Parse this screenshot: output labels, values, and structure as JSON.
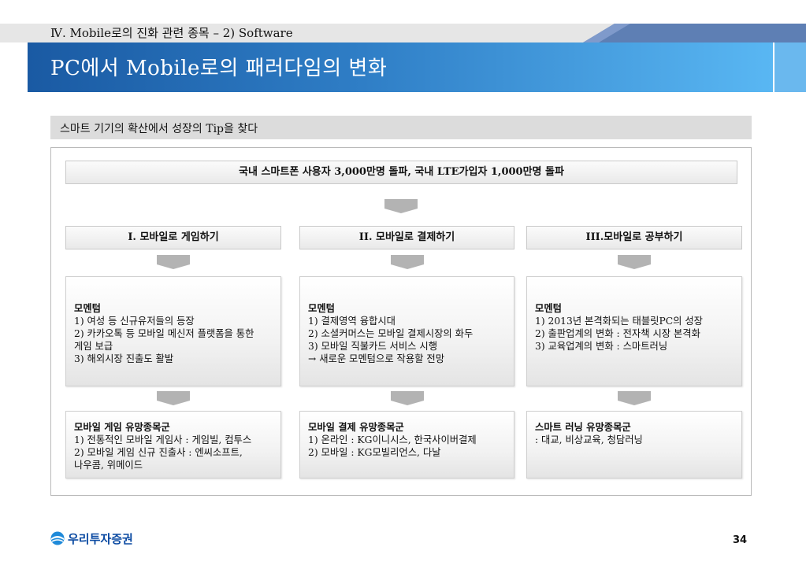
{
  "header": {
    "section_label": "Ⅳ. Mobile로의 진화 관련 종목 – 2) Software",
    "page_title": "PC에서 Mobile로의 패러다임의 변화"
  },
  "sub_heading": "스마트 기기의 확산에서 성장의 Tip을 찾다",
  "summary": "국내 스마트폰 사용자 3,000만명 돌파, 국내 LTE가입자 1,000만명 돌파",
  "columns": [
    {
      "heading": "I. 모바일로 게임하기",
      "momentum": {
        "title": "모멘텀",
        "lines": [
          "1) 여성 등 신규유저들의 등장",
          "2) 카카오톡 등 모바일 메신저 플랫폼을 통한",
          " 게임 보급",
          "3) 해외시장 진출도 활발"
        ]
      },
      "stocks": {
        "title": "모바일 게임 유망종목군",
        "lines": [
          "1) 전통적인 모바일 게임사 : 게임빌, 컴투스",
          "2) 모바일 게임 신규 진출사 : 엔씨소프트,",
          "나우콤, 위메이드"
        ]
      }
    },
    {
      "heading": "II. 모바일로 결제하기",
      "momentum": {
        "title": "모멘텀",
        "lines": [
          "1) 결제영역 융합시대",
          "2) 소셜커머스는 모바일 결제시장의 화두",
          "3) 모바일 직불카드 서비스 시행",
          " → 새로운 모멘텀으로 작용할 전망"
        ]
      },
      "stocks": {
        "title": "모바일 결제 유망종목군",
        "lines": [
          "1) 온라인 : KG이니시스, 한국사이버결제",
          "2) 모바일 : KG모빌리언스, 다날"
        ]
      }
    },
    {
      "heading": "III.모바일로 공부하기",
      "momentum": {
        "title": "모멘텀",
        "lines": [
          "1) 2013년 본격화되는 태블릿PC의 성장",
          "2) 출판업계의 변화 : 전자책 시장 본격화",
          "3) 교육업계의 변화 : 스마트러닝"
        ]
      },
      "stocks": {
        "title": "스마트 러닝 유망종목군",
        "lines": [
          ": 대교, 비상교육, 청담러닝"
        ]
      }
    }
  ],
  "footer": {
    "logo_text": "우리투자증권",
    "page_number": "34"
  },
  "colors": {
    "title_bar_start": "#1a5aa3",
    "title_bar_end": "#59b7f3",
    "arrow_gray": "#b3b3b3",
    "logo_blue": "#0b4aa2"
  }
}
